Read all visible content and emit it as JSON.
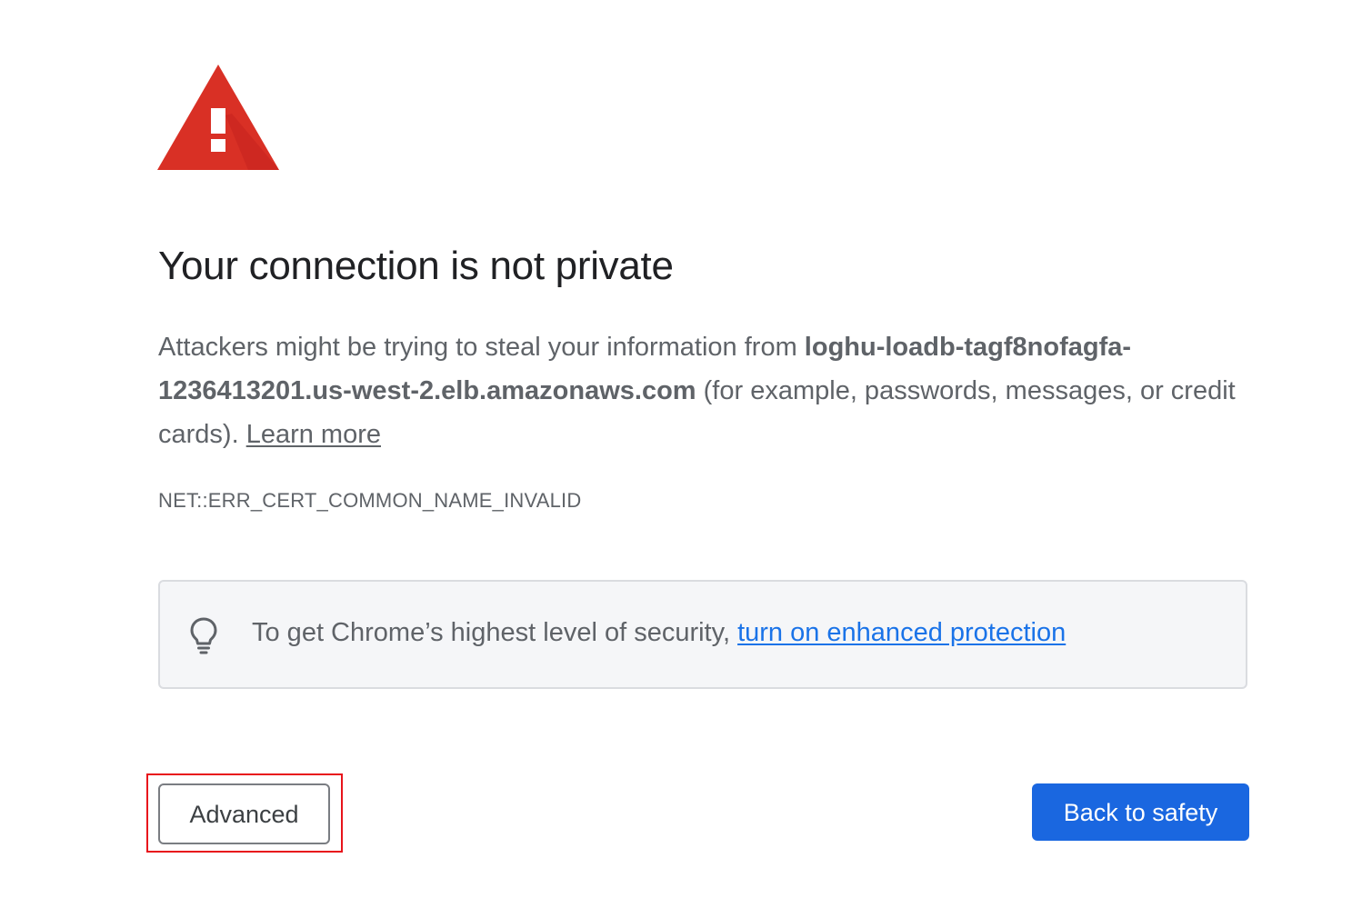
{
  "icons": {
    "warning": "warning-triangle-icon",
    "promo": "lightbulb-icon"
  },
  "colors": {
    "warning_red": "#d93025",
    "text": "#202124",
    "secondary_text": "#5f6368",
    "link_blue": "#1a73e8",
    "primary_button": "#1a67e0",
    "highlight": "#e8141b"
  },
  "title": "Your connection is not private",
  "explanation": {
    "prefix": "Attackers might be trying to steal your information from ",
    "host_part1": "loghu-loadb-tagf8nofagfa-",
    "host_part2": "1236413201.us-west-2.elb.amazonaws.com",
    "suffix": " (for example, passwords, messages, or credit cards). ",
    "learn_more": "Learn more"
  },
  "error_code": "NET::ERR_CERT_COMMON_NAME_INVALID",
  "promo": {
    "text": "To get Chrome’s highest level of security, ",
    "link": "turn on enhanced protection"
  },
  "buttons": {
    "advanced": "Advanced",
    "back_to_safety": "Back to safety"
  }
}
